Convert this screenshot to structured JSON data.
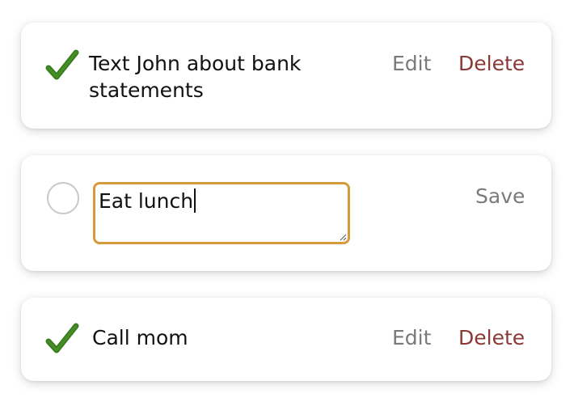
{
  "todos": [
    {
      "text": "Text John about bank statements",
      "completed": true,
      "status_icon": "checkmark-icon",
      "edit_label": "Edit",
      "delete_label": "Delete"
    },
    {
      "text": "Eat lunch",
      "completed": false,
      "editing": true,
      "status_icon": "empty-circle-icon",
      "save_label": "Save"
    },
    {
      "text": "Call mom",
      "completed": true,
      "status_icon": "checkmark-icon",
      "edit_label": "Edit",
      "delete_label": "Delete"
    }
  ],
  "colors": {
    "checkmark": "#3a7d1f",
    "edit_border": "#d59a3a",
    "delete": "#8a3a36",
    "muted_action": "#7a7a7a",
    "circle_border": "#c8c8c8"
  }
}
